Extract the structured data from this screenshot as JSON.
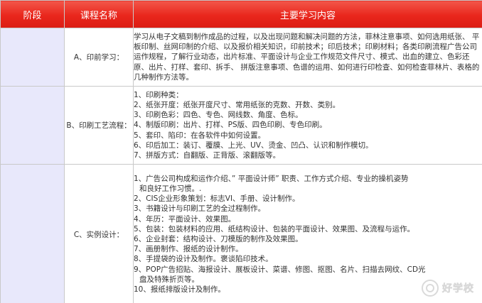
{
  "table": {
    "headers": {
      "stage": "阶段",
      "course": "课程名称",
      "content": "主要学习内容"
    },
    "rows": [
      {
        "stage": "",
        "course": "A、印前学习：",
        "lines": [
          " 学习从电子文稿到制作成品的过程，以及出现问题和解决问题的方法，菲林注意事项、如何选用纸张、 平板印制、丝网印制的介绍、以及报价相关知识，印前技术；印后技术；印刷材料；各类印刷流程广告公司运作规程，了解行业动态，出片标准、平面设计与企业工作规范文件尺寸、模式、出血的建立、色彩还原、出片、打样、套印、拆手、 拼版注意事项、色谱的运用、如何进行印检查、如何检查菲林片、表格的几种制作方法等。"
        ]
      },
      {
        "stage": "",
        "course": "B、印刷工艺流程：",
        "lines": [
          "1、印刷种类：",
          "2、纸张开度：纸张开度尺寸、常用纸张的克数、开数、类别。",
          "3、印刷色彩：四色、专色、网线数、角度、色标。",
          "4、制版印刷：出片、打样、PS版、四色印刷、专色印刷。",
          "5、套印、陷印：在各软件中如何设置。",
          " 6、印后加工：装订、覆膜、上光、UV、烫金、凹凸、认识和制作模切。",
          " 7、拼版方式：自翻版、正背版、滚翻版等。"
        ]
      },
      {
        "stage": "",
        "course": "C、实例设计：",
        "lines": [
          "1、广告公司构成和运作介绍、” 平面设计师” 职责、工作方式介绍、专业的操机姿势",
          "   和良好工作习惯。.",
          "2、CIS企业形象策划：标志VI、手册、设计制作。",
          "3、书籍设计与印刷工艺的全过程制作。",
          "4、年历：平面设计、效果图。",
          "5、包装：包装材料的应用、纸结构设计、包装的平面设计、效果图、及流程与运作。",
          "6、企业封套：结构设计、刀模版的制作及效果图。",
          "7、画册制作、报纸的设计制作。",
          "8、手提袋的设计及制作。褒谈陷印技术。",
          "9、POP广告招贴、海报设计、展板设计、菜谱、修图、抠图、名片、扫描去网纹、CD光",
          "   盘及特殊折页等。",
          "10、报纸排版设计及制作。"
        ]
      }
    ]
  },
  "watermark": {
    "text": "好学校"
  }
}
